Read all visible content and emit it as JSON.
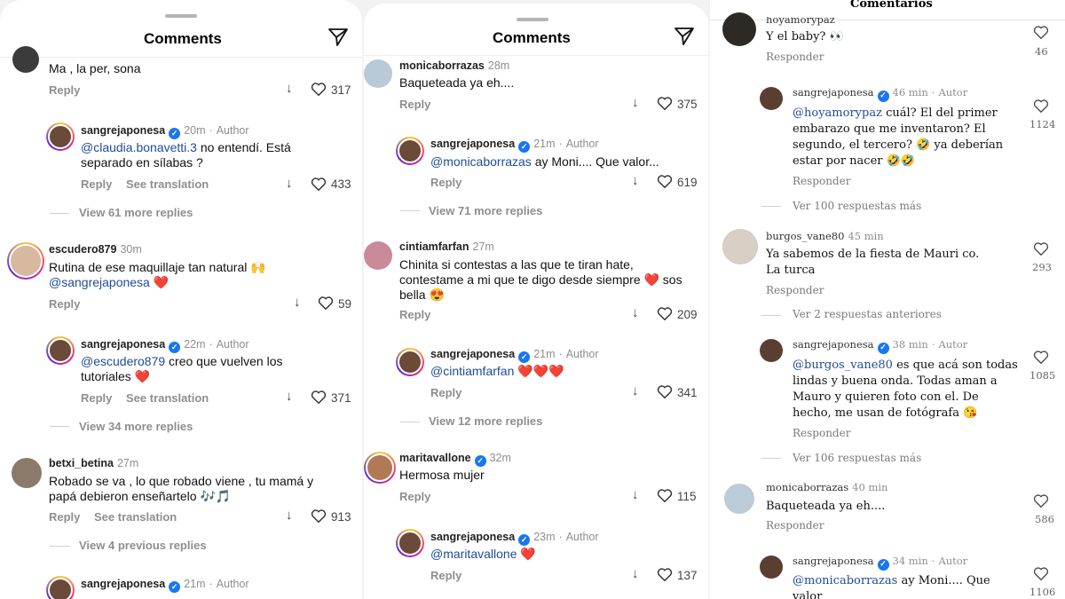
{
  "panel1": {
    "header_title": "Comments",
    "comments": [
      {
        "text": "Ma , la  per, sona",
        "reply": "Reply",
        "likes": "317"
      },
      {
        "user": "sangrejaponesa",
        "time": "20m",
        "author": "Author",
        "mention": "@claudia.bonavetti.3",
        "text": " no entendí. Está separado en sílabas ?",
        "reply": "Reply",
        "see_translation": "See translation",
        "likes": "433"
      },
      {
        "view_more": "View 61 more replies"
      },
      {
        "user": "escudero879",
        "time": "30m",
        "text": "Rutina de ese maquillaje tan natural 🙌",
        "mention": "@sangrejaponesa",
        "emoji": "❤️",
        "reply": "Reply",
        "likes": "59"
      },
      {
        "user": "sangrejaponesa",
        "time": "22m",
        "author": "Author",
        "mention": "@escudero879",
        "text": " creo que vuelven los tutoriales",
        "emoji": "❤️",
        "reply": "Reply",
        "see_translation": "See translation",
        "likes": "371"
      },
      {
        "view_more": "View 34 more replies"
      },
      {
        "user": "betxi_betina",
        "time": "27m",
        "text": "Robado se va , lo que robado viene , tu mamá y papá debieron enseñartelo 🎶🎵",
        "reply": "Reply",
        "see_translation": "See translation",
        "likes": "913"
      },
      {
        "view_more": "View 4 previous replies"
      },
      {
        "user": "sangrejaponesa",
        "time": "21m",
        "author": "Author"
      }
    ]
  },
  "panel2": {
    "header_title": "Comments",
    "comments": [
      {
        "user": "monicaborrazas",
        "time": "28m",
        "text": "Baqueteada ya eh....",
        "reply": "Reply",
        "likes": "375"
      },
      {
        "user": "sangrejaponesa",
        "time": "21m",
        "author": "Author",
        "mention": "@monicaborrazas",
        "text": " ay Moni.... Que valor...",
        "reply": "Reply",
        "likes": "619"
      },
      {
        "view_more": "View 71 more replies"
      },
      {
        "user": "cintiamfarfan",
        "time": "27m",
        "text": "Chinita si contestas a las que te tiran hate, contestame a mi que te digo desde siempre ❤️ sos bella 😍",
        "reply": "Reply",
        "likes": "209"
      },
      {
        "user": "sangrejaponesa",
        "time": "21m",
        "author": "Author",
        "mention": "@cintiamfarfan",
        "emoji": "❤️❤️❤️",
        "reply": "Reply",
        "likes": "341"
      },
      {
        "view_more": "View 12 more replies"
      },
      {
        "user": "maritavallone",
        "time": "32m",
        "text": "Hermosa mujer",
        "reply": "Reply",
        "likes": "115"
      },
      {
        "user": "sangrejaponesa",
        "time": "23m",
        "author": "Author",
        "mention": "@maritavallone",
        "emoji": "❤️",
        "reply": "Reply",
        "likes": "137"
      }
    ]
  },
  "panel3": {
    "header_title": "Comentarios",
    "comments": [
      {
        "user": "hoyamorypaz",
        "text": "Y el baby? 👀",
        "reply": "Responder",
        "likes": "46"
      },
      {
        "user": "sangrejaponesa",
        "time": "46 min",
        "author": "Autor",
        "mention": "@hoyamorypaz",
        "text": " cuál? El del primer embarazo que me inventaron? El segundo, el tercero? 🤣 ya deberían estar por nacer 🤣🤣",
        "reply": "Responder",
        "likes": "1124"
      },
      {
        "view_more": "Ver 100 respuestas más"
      },
      {
        "user": "burgos_vane80",
        "time": "45 min",
        "text": "Ya sabemos de la fiesta de Mauri co. La turca",
        "reply": "Responder",
        "likes": "293"
      },
      {
        "view_more": "Ver 2 respuestas anteriores"
      },
      {
        "user": "sangrejaponesa",
        "time": "38 min",
        "author": "Autor",
        "mention": "@burgos_vane80",
        "text": " es que acá son todas lindas y buena onda. Todas aman a Mauro y quieren foto con el. De hecho, me usan de fotógrafa 😘",
        "reply": "Responder",
        "likes": "1085"
      },
      {
        "view_more": "Ver 106 respuestas más"
      },
      {
        "user": "monicaborrazas",
        "time": "40 min",
        "text": "Baqueteada ya eh....",
        "reply": "Responder",
        "likes": "586"
      },
      {
        "user": "sangrejaponesa",
        "time": "34 min",
        "author": "Autor",
        "mention": "@monicaborrazas",
        "text": " ay Moni.... Que valor",
        "likes": "1106"
      }
    ]
  },
  "icons": {
    "send": "send-icon",
    "heart": "heart-icon",
    "dislike": "down-arrow-icon",
    "verified": "verified-badge-icon"
  },
  "colors": {
    "mention": "#1f4b99",
    "verified": "#1877f2",
    "meta": "#8e8e8e"
  }
}
